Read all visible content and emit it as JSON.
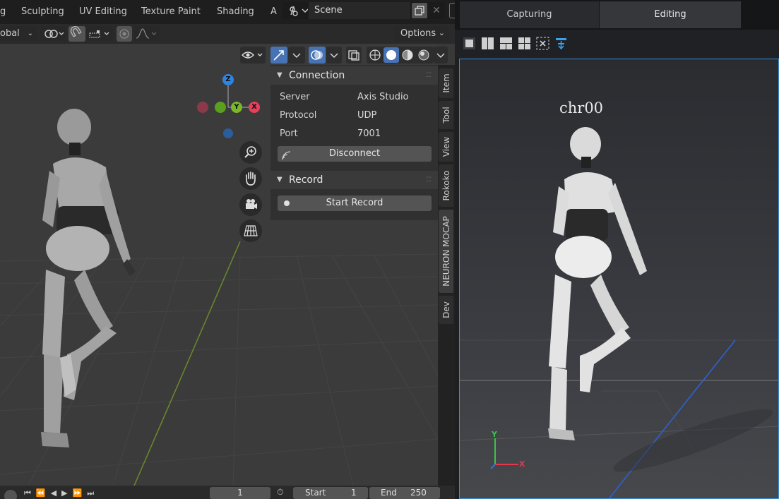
{
  "blender": {
    "workspace_tabs": [
      "g",
      "Sculpting",
      "UV Editing",
      "Texture Paint",
      "Shading",
      "A"
    ],
    "scene_label": "Scene",
    "transform_orientation": "obal",
    "options_label": "Options",
    "gizmo": {
      "z": "Z",
      "y": "Y",
      "x": "X"
    },
    "npanel": {
      "connection": {
        "title": "Connection",
        "server_label": "Server",
        "server_value": "Axis Studio",
        "protocol_label": "Protocol",
        "protocol_value": "UDP",
        "port_label": "Port",
        "port_value": "7001",
        "disconnect_label": "Disconnect"
      },
      "record": {
        "title": "Record",
        "start_record_label": "Start Record"
      }
    },
    "side_tabs": [
      "Item",
      "Tool",
      "View",
      "Rokoko",
      "NEURON MOCAP",
      "Dev"
    ],
    "timeline": {
      "current_frame": "1",
      "start_label": "Start",
      "start_value": "1",
      "end_label": "End",
      "end_value": "250"
    },
    "colors": {
      "accent": "#4772b3",
      "x_axis": "#e8405a",
      "y_axis": "#7ab82a",
      "z_axis": "#2f84e3"
    }
  },
  "axis_studio": {
    "tabs": [
      "Capturing",
      "Editing"
    ],
    "active_tab": "Editing",
    "character_label": "chr00",
    "axes": {
      "y": "Y",
      "x": "X"
    },
    "colors": {
      "selection_border": "#3a8fd6"
    }
  }
}
